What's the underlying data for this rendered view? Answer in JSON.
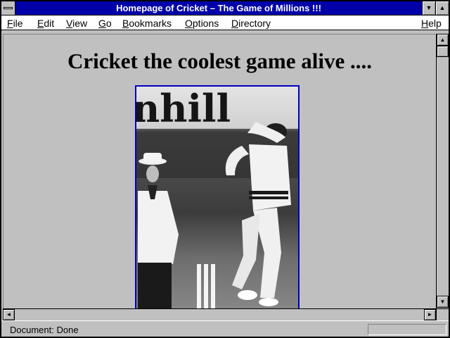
{
  "window": {
    "title": "Homepage of Cricket – The Game of Millions !!!",
    "minimize_glyph": "▼",
    "maximize_glyph": "▲"
  },
  "menu": {
    "items": [
      {
        "key": "F",
        "rest": "ile"
      },
      {
        "key": "E",
        "rest": "dit"
      },
      {
        "key": "V",
        "rest": "iew"
      },
      {
        "key": "G",
        "rest": "o"
      },
      {
        "key": "B",
        "rest": "ookmarks"
      },
      {
        "key": "O",
        "rest": "ptions"
      },
      {
        "key": "D",
        "rest": "irectory"
      },
      {
        "key": "H",
        "rest": "elp"
      }
    ]
  },
  "page": {
    "heading": "Cricket the coolest game alive ...."
  },
  "photo": {
    "sign_text": "nhill"
  },
  "scrollbars": {
    "up_glyph": "▲",
    "down_glyph": "▼",
    "left_glyph": "◄",
    "right_glyph": "►"
  },
  "status": {
    "text": "Document: Done"
  },
  "colors": {
    "titlebar": "#0000a8",
    "chrome": "#c0c0c0",
    "photo_border": "#0000c0"
  }
}
